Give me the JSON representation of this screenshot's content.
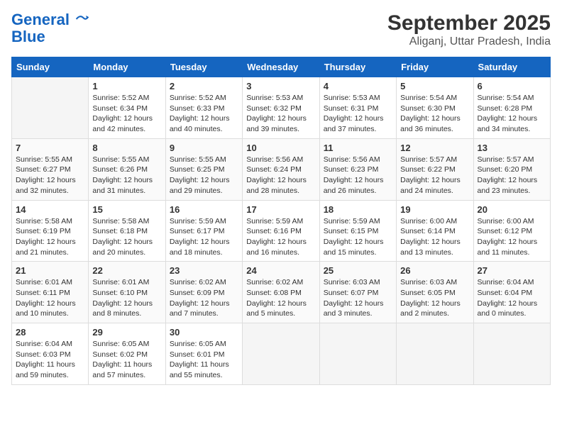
{
  "logo": {
    "line1": "General",
    "line2": "Blue"
  },
  "title": "September 2025",
  "subtitle": "Aliganj, Uttar Pradesh, India",
  "days_of_week": [
    "Sunday",
    "Monday",
    "Tuesday",
    "Wednesday",
    "Thursday",
    "Friday",
    "Saturday"
  ],
  "weeks": [
    [
      {
        "num": "",
        "detail": ""
      },
      {
        "num": "1",
        "detail": "Sunrise: 5:52 AM\nSunset: 6:34 PM\nDaylight: 12 hours\nand 42 minutes."
      },
      {
        "num": "2",
        "detail": "Sunrise: 5:52 AM\nSunset: 6:33 PM\nDaylight: 12 hours\nand 40 minutes."
      },
      {
        "num": "3",
        "detail": "Sunrise: 5:53 AM\nSunset: 6:32 PM\nDaylight: 12 hours\nand 39 minutes."
      },
      {
        "num": "4",
        "detail": "Sunrise: 5:53 AM\nSunset: 6:31 PM\nDaylight: 12 hours\nand 37 minutes."
      },
      {
        "num": "5",
        "detail": "Sunrise: 5:54 AM\nSunset: 6:30 PM\nDaylight: 12 hours\nand 36 minutes."
      },
      {
        "num": "6",
        "detail": "Sunrise: 5:54 AM\nSunset: 6:28 PM\nDaylight: 12 hours\nand 34 minutes."
      }
    ],
    [
      {
        "num": "7",
        "detail": "Sunrise: 5:55 AM\nSunset: 6:27 PM\nDaylight: 12 hours\nand 32 minutes."
      },
      {
        "num": "8",
        "detail": "Sunrise: 5:55 AM\nSunset: 6:26 PM\nDaylight: 12 hours\nand 31 minutes."
      },
      {
        "num": "9",
        "detail": "Sunrise: 5:55 AM\nSunset: 6:25 PM\nDaylight: 12 hours\nand 29 minutes."
      },
      {
        "num": "10",
        "detail": "Sunrise: 5:56 AM\nSunset: 6:24 PM\nDaylight: 12 hours\nand 28 minutes."
      },
      {
        "num": "11",
        "detail": "Sunrise: 5:56 AM\nSunset: 6:23 PM\nDaylight: 12 hours\nand 26 minutes."
      },
      {
        "num": "12",
        "detail": "Sunrise: 5:57 AM\nSunset: 6:22 PM\nDaylight: 12 hours\nand 24 minutes."
      },
      {
        "num": "13",
        "detail": "Sunrise: 5:57 AM\nSunset: 6:20 PM\nDaylight: 12 hours\nand 23 minutes."
      }
    ],
    [
      {
        "num": "14",
        "detail": "Sunrise: 5:58 AM\nSunset: 6:19 PM\nDaylight: 12 hours\nand 21 minutes."
      },
      {
        "num": "15",
        "detail": "Sunrise: 5:58 AM\nSunset: 6:18 PM\nDaylight: 12 hours\nand 20 minutes."
      },
      {
        "num": "16",
        "detail": "Sunrise: 5:59 AM\nSunset: 6:17 PM\nDaylight: 12 hours\nand 18 minutes."
      },
      {
        "num": "17",
        "detail": "Sunrise: 5:59 AM\nSunset: 6:16 PM\nDaylight: 12 hours\nand 16 minutes."
      },
      {
        "num": "18",
        "detail": "Sunrise: 5:59 AM\nSunset: 6:15 PM\nDaylight: 12 hours\nand 15 minutes."
      },
      {
        "num": "19",
        "detail": "Sunrise: 6:00 AM\nSunset: 6:14 PM\nDaylight: 12 hours\nand 13 minutes."
      },
      {
        "num": "20",
        "detail": "Sunrise: 6:00 AM\nSunset: 6:12 PM\nDaylight: 12 hours\nand 11 minutes."
      }
    ],
    [
      {
        "num": "21",
        "detail": "Sunrise: 6:01 AM\nSunset: 6:11 PM\nDaylight: 12 hours\nand 10 minutes."
      },
      {
        "num": "22",
        "detail": "Sunrise: 6:01 AM\nSunset: 6:10 PM\nDaylight: 12 hours\nand 8 minutes."
      },
      {
        "num": "23",
        "detail": "Sunrise: 6:02 AM\nSunset: 6:09 PM\nDaylight: 12 hours\nand 7 minutes."
      },
      {
        "num": "24",
        "detail": "Sunrise: 6:02 AM\nSunset: 6:08 PM\nDaylight: 12 hours\nand 5 minutes."
      },
      {
        "num": "25",
        "detail": "Sunrise: 6:03 AM\nSunset: 6:07 PM\nDaylight: 12 hours\nand 3 minutes."
      },
      {
        "num": "26",
        "detail": "Sunrise: 6:03 AM\nSunset: 6:05 PM\nDaylight: 12 hours\nand 2 minutes."
      },
      {
        "num": "27",
        "detail": "Sunrise: 6:04 AM\nSunset: 6:04 PM\nDaylight: 12 hours\nand 0 minutes."
      }
    ],
    [
      {
        "num": "28",
        "detail": "Sunrise: 6:04 AM\nSunset: 6:03 PM\nDaylight: 11 hours\nand 59 minutes."
      },
      {
        "num": "29",
        "detail": "Sunrise: 6:05 AM\nSunset: 6:02 PM\nDaylight: 11 hours\nand 57 minutes."
      },
      {
        "num": "30",
        "detail": "Sunrise: 6:05 AM\nSunset: 6:01 PM\nDaylight: 11 hours\nand 55 minutes."
      },
      {
        "num": "",
        "detail": ""
      },
      {
        "num": "",
        "detail": ""
      },
      {
        "num": "",
        "detail": ""
      },
      {
        "num": "",
        "detail": ""
      }
    ]
  ]
}
